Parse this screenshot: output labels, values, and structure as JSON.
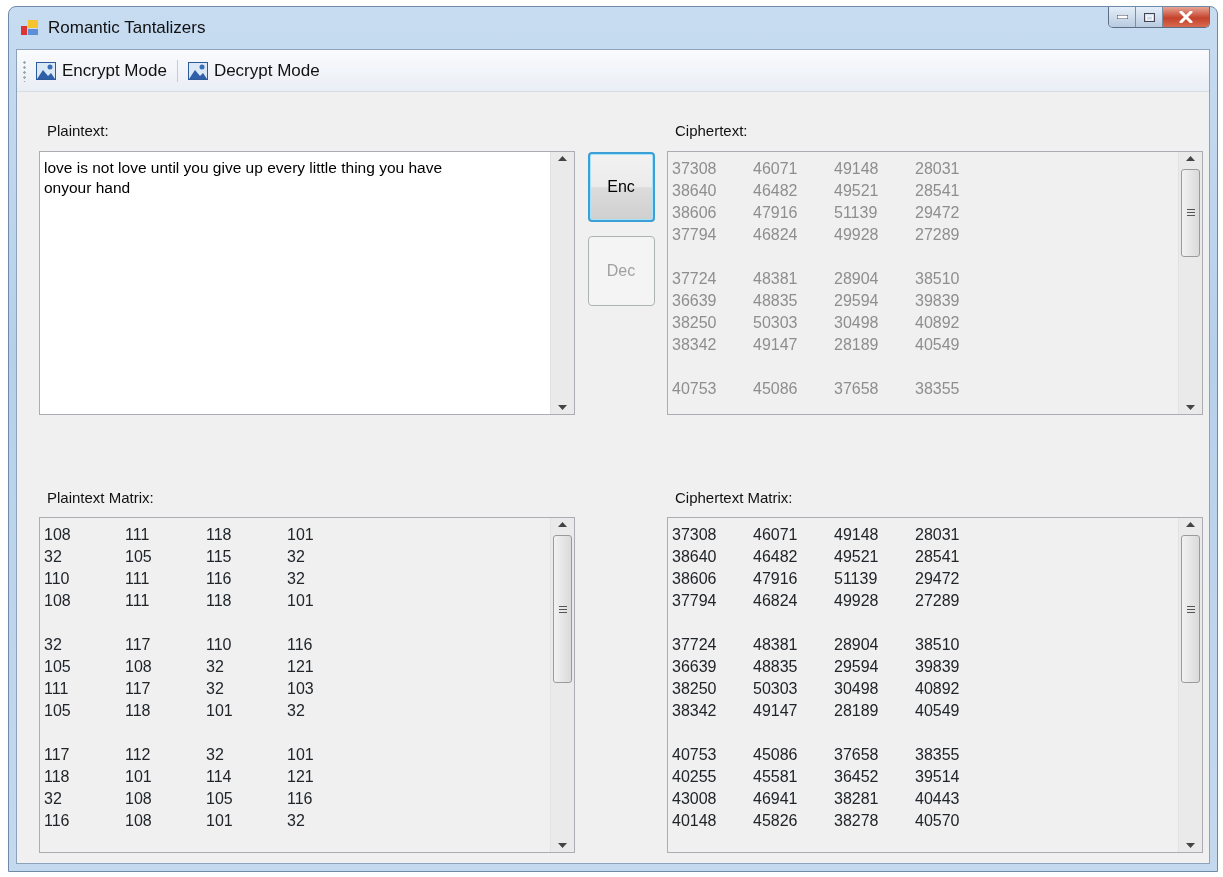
{
  "window": {
    "title": "Romantic Tantalizers"
  },
  "toolbar": [
    {
      "label": "Encrypt Mode"
    },
    {
      "label": "Decrypt Mode"
    }
  ],
  "plaintext": {
    "label": "Plaintext:",
    "value": "love is not love until you give up every little thing you have onyour hand"
  },
  "buttons": [
    {
      "label": "Enc",
      "focused": true,
      "disabled": false
    },
    {
      "label": "Dec",
      "focused": false,
      "disabled": true
    }
  ],
  "ciphertext": {
    "label": "Ciphertext:",
    "disabled": true,
    "groups": [
      [
        [
          "37308",
          "46071",
          "49148",
          "28031"
        ],
        [
          "38640",
          "46482",
          "49521",
          "28541"
        ],
        [
          "38606",
          "47916",
          "51139",
          "29472"
        ],
        [
          "37794",
          "46824",
          "49928",
          "27289"
        ]
      ],
      [
        [
          "37724",
          "48381",
          "28904",
          "38510"
        ],
        [
          "36639",
          "48835",
          "29594",
          "39839"
        ],
        [
          "38250",
          "50303",
          "30498",
          "40892"
        ],
        [
          "38342",
          "49147",
          "28189",
          "40549"
        ]
      ],
      [
        [
          "40753",
          "45086",
          "37658",
          "38355"
        ]
      ]
    ]
  },
  "plaintext_matrix": {
    "label": "Plaintext Matrix:",
    "disabled": false,
    "groups": [
      [
        [
          "108",
          "111",
          "118",
          "101"
        ],
        [
          "32",
          "105",
          "115",
          "32"
        ],
        [
          "110",
          "111",
          "116",
          "32"
        ],
        [
          "108",
          "111",
          "118",
          "101"
        ]
      ],
      [
        [
          "32",
          "117",
          "110",
          "116"
        ],
        [
          "105",
          "108",
          "32",
          "121"
        ],
        [
          "111",
          "117",
          "32",
          "103"
        ],
        [
          "105",
          "118",
          "101",
          "32"
        ]
      ],
      [
        [
          "117",
          "112",
          "32",
          "101"
        ],
        [
          "118",
          "101",
          "114",
          "121"
        ],
        [
          "32",
          "108",
          "105",
          "116"
        ],
        [
          "116",
          "108",
          "101",
          "32"
        ]
      ]
    ]
  },
  "ciphertext_matrix": {
    "label": "Ciphertext Matrix:",
    "disabled": false,
    "groups": [
      [
        [
          "37308",
          "46071",
          "49148",
          "28031"
        ],
        [
          "38640",
          "46482",
          "49521",
          "28541"
        ],
        [
          "38606",
          "47916",
          "51139",
          "29472"
        ],
        [
          "37794",
          "46824",
          "49928",
          "27289"
        ]
      ],
      [
        [
          "37724",
          "48381",
          "28904",
          "38510"
        ],
        [
          "36639",
          "48835",
          "29594",
          "39839"
        ],
        [
          "38250",
          "50303",
          "30498",
          "40892"
        ],
        [
          "38342",
          "49147",
          "28189",
          "40549"
        ]
      ],
      [
        [
          "40753",
          "45086",
          "37658",
          "38355"
        ],
        [
          "40255",
          "45581",
          "36452",
          "39514"
        ],
        [
          "43008",
          "46941",
          "38281",
          "40443"
        ],
        [
          "40148",
          "45826",
          "38278",
          "40570"
        ]
      ]
    ]
  }
}
